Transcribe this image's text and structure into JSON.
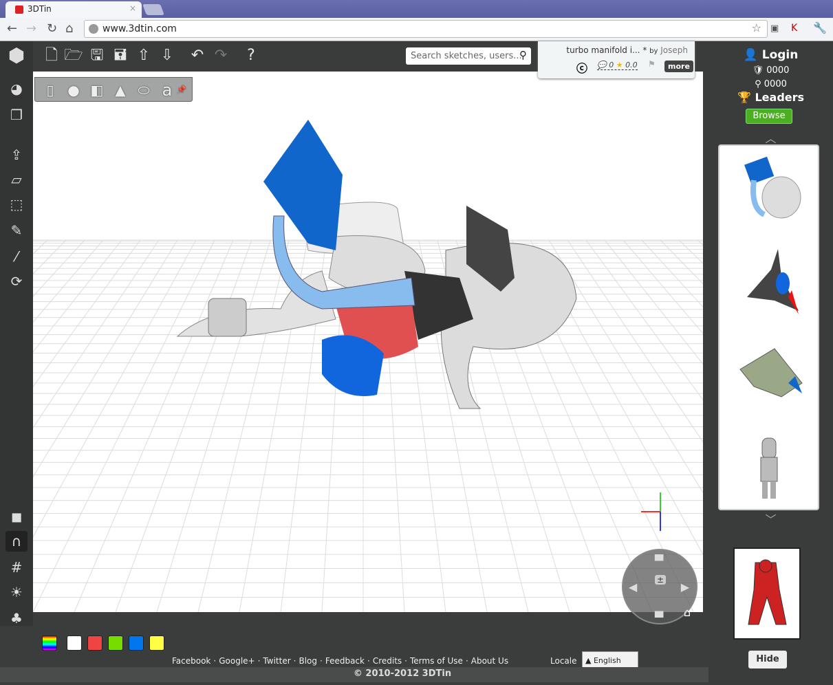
{
  "browser": {
    "tab_title": "3DTin",
    "url": "www.3dtin.com",
    "icons": [
      "back-icon",
      "forward-icon",
      "reload-icon",
      "home-icon",
      "star-icon",
      "wrench-icon"
    ]
  },
  "toolbar": {
    "items": [
      "new",
      "open",
      "save",
      "save-as",
      "upload",
      "download",
      "undo",
      "redo",
      "help"
    ]
  },
  "shapes": {
    "items": [
      "cylinder",
      "sphere",
      "box",
      "cone",
      "torus",
      "text"
    ],
    "text_glyph": "a"
  },
  "search": {
    "placeholder": "Search sketches, users..."
  },
  "sketch": {
    "title": "turbo manifold i...",
    "marker": "*",
    "by": "by",
    "author": "Joseph",
    "comments": "0",
    "rating": "0.0",
    "more": "more"
  },
  "user": {
    "login": "Login",
    "score1": "0000",
    "score2": "0000",
    "leaders": "Leaders",
    "browse": "Browse",
    "hide": "Hide"
  },
  "palette": {
    "colors": [
      "#ffffff",
      "#ef4444",
      "#77dd00",
      "#0077ee",
      "#ffff44"
    ]
  },
  "footer": {
    "links": [
      "Facebook",
      "Google+",
      "Twitter",
      "Blog",
      "Feedback",
      "Credits",
      "Terms of Use",
      "About Us"
    ],
    "locale_label": "Locale",
    "locale_value": "English",
    "copyright": "© 2010-2012 3DTin"
  }
}
